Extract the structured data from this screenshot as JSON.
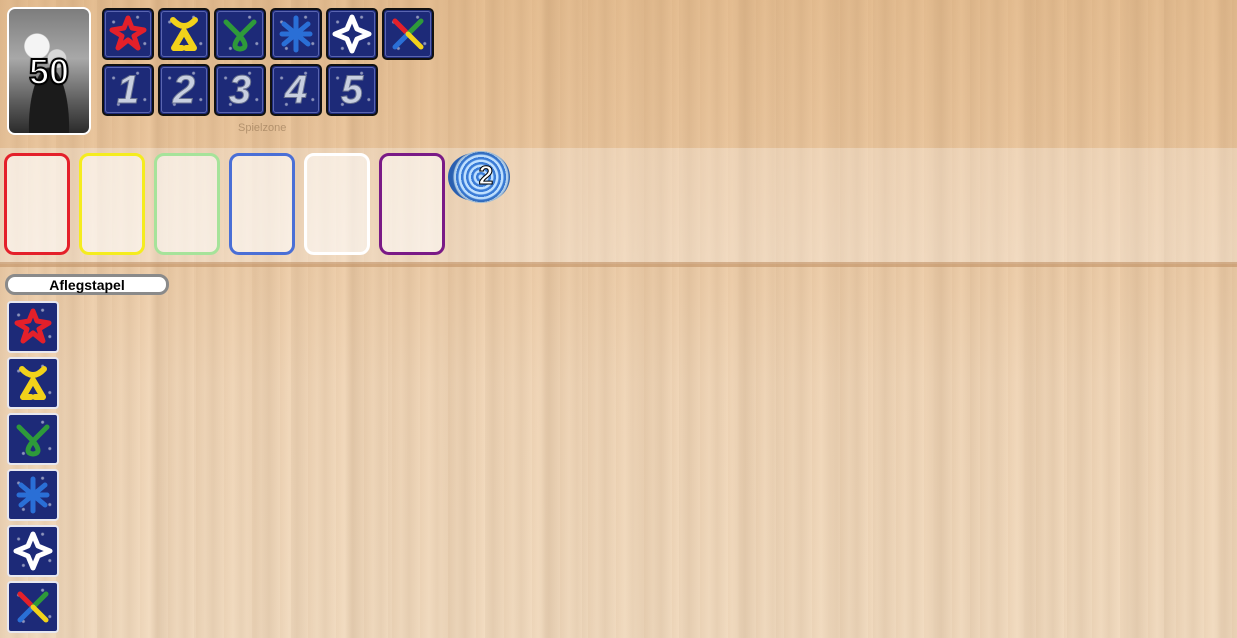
{
  "deck": {
    "count": "50"
  },
  "symbol_cards": [
    {
      "name": "red-shuriken-card",
      "color": "#e4202a",
      "glyph": "✣"
    },
    {
      "name": "yellow-x-card",
      "color": "#f2d21a",
      "glyph": "X"
    },
    {
      "name": "green-loop-card",
      "color": "#2e9a3a",
      "glyph": "ᐁ"
    },
    {
      "name": "blue-star-card",
      "color": "#2a6fd6",
      "glyph": "✱"
    },
    {
      "name": "white-star-card",
      "color": "#ffffff",
      "glyph": "✦"
    },
    {
      "name": "multicolor-x-card",
      "color": "#e4202a",
      "glyph": "✕"
    }
  ],
  "number_cards": [
    "1",
    "2",
    "3",
    "4",
    "5"
  ],
  "zone_label": "Spielzone",
  "slots": [
    {
      "color": "#e4202a"
    },
    {
      "color": "#f5ec1e"
    },
    {
      "color": "#a6e39a"
    },
    {
      "color": "#4a6fd6"
    },
    {
      "color": "#ffffff"
    },
    {
      "color": "#7a1a86"
    }
  ],
  "token": {
    "count": "2"
  },
  "discard": {
    "label": "Aflegstapel"
  }
}
